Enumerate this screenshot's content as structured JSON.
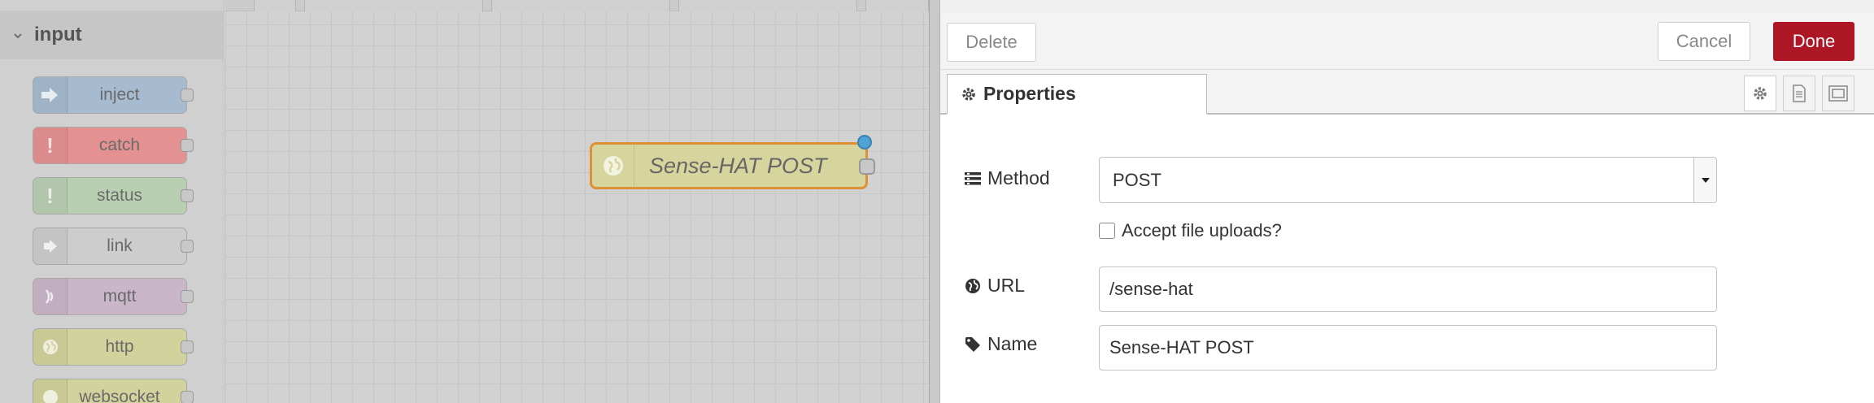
{
  "palette": {
    "category": "input",
    "nodes": [
      {
        "label": "inject",
        "color": "#a6bbcf",
        "icon": "arrow-in-icon"
      },
      {
        "label": "catch",
        "color": "#e49191",
        "icon": "alert-icon"
      },
      {
        "label": "status",
        "color": "#c0deed",
        "icon": "alert-icon"
      },
      {
        "label": "link",
        "color": "#dddddd",
        "icon": "link-in-icon"
      },
      {
        "label": "mqtt",
        "color": "#d8bfd8",
        "icon": "bridge-icon"
      },
      {
        "label": "http",
        "color": "#e7e7ae",
        "icon": "globe-icon"
      },
      {
        "label": "websocket",
        "color": "#e7e7ae",
        "icon": "globe-icon"
      }
    ]
  },
  "workspace": {
    "node_label": "Sense-HAT POST",
    "node_color": "#e7e7ae",
    "selected_border": "#ff7f0e"
  },
  "tray": {
    "delete_label": "Delete",
    "cancel_label": "Cancel",
    "done_label": "Done",
    "done_color": "#ad1625",
    "tab_label": "Properties",
    "method_label": "Method",
    "method_value": "POST",
    "upload_label": "Accept file uploads?",
    "upload_checked": false,
    "url_label": "URL",
    "url_value": "/sense-hat",
    "name_label": "Name",
    "name_value": "Sense-HAT POST"
  }
}
